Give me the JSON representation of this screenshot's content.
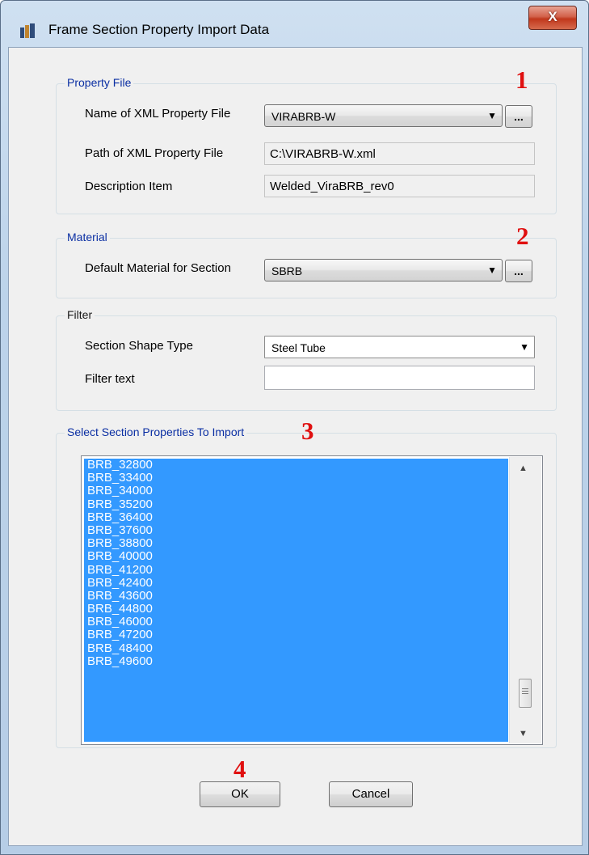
{
  "window": {
    "title": "Frame Section Property Import Data",
    "close_label": "X"
  },
  "property_file": {
    "title": "Property File",
    "xml_name_label": "Name of XML Property File",
    "xml_name_value": "VIRABRB-W",
    "browse_label": "...",
    "xml_path_label": "Path of XML Property File",
    "xml_path_value": "C:\\VIRABRB-W.xml",
    "description_label": "Description Item",
    "description_value": "Welded_ViraBRB_rev0"
  },
  "material": {
    "title": "Material",
    "default_label": "Default Material for Section",
    "default_value": "SBRB",
    "browse_label": "..."
  },
  "filter": {
    "title": "Filter",
    "shape_label": "Section Shape Type",
    "shape_value": "Steel Tube",
    "text_label": "Filter text",
    "text_value": ""
  },
  "import": {
    "title": "Select Section Properties To Import",
    "items": [
      "BRB_32800",
      "BRB_33400",
      "BRB_34000",
      "BRB_35200",
      "BRB_36400",
      "BRB_37600",
      "BRB_38800",
      "BRB_40000",
      "BRB_41200",
      "BRB_42400",
      "BRB_43600",
      "BRB_44800",
      "BRB_46000",
      "BRB_47200",
      "BRB_48400",
      "BRB_49600"
    ]
  },
  "buttons": {
    "ok": "OK",
    "cancel": "Cancel"
  },
  "annotations": {
    "n1": "1",
    "n2": "2",
    "n3": "3",
    "n4": "4"
  },
  "colors": {
    "selection": "#3399ff",
    "group_title": "#0b2fa3",
    "annotation": "#e01010"
  }
}
